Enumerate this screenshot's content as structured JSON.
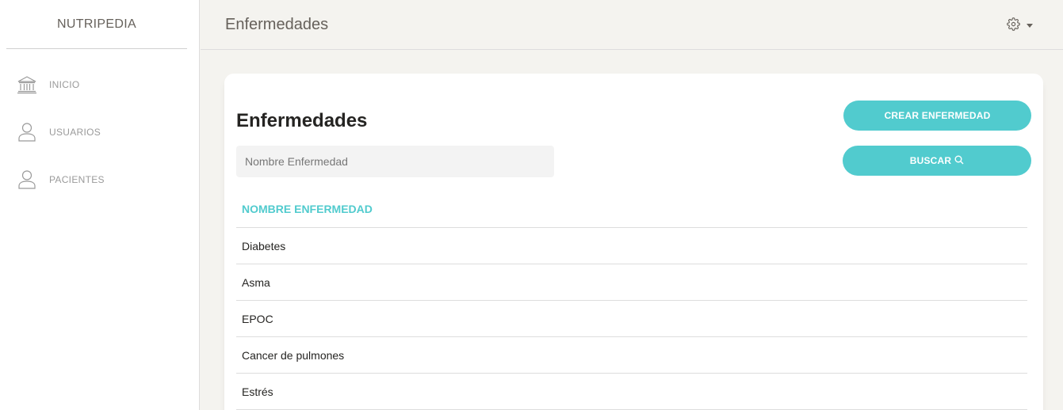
{
  "sidebar": {
    "brand": "NUTRIPEDIA",
    "items": [
      {
        "label": "INICIO",
        "icon": "bank-icon"
      },
      {
        "label": "USUARIOS",
        "icon": "user-icon"
      },
      {
        "label": "PACIENTES",
        "icon": "user-icon"
      }
    ]
  },
  "header": {
    "title": "Enfermedades",
    "settings_icon": "gear-icon"
  },
  "main": {
    "title": "Enfermedades",
    "search": {
      "placeholder": "Nombre Enfermedad",
      "value": ""
    },
    "create_button": "CREAR ENFERMEDAD",
    "search_button": "BUSCAR",
    "table": {
      "columns": [
        "NOMBRE ENFERMEDAD"
      ],
      "rows": [
        "Diabetes",
        "Asma",
        "EPOC",
        "Cancer de pulmones",
        "Estrés"
      ]
    }
  },
  "colors": {
    "accent": "#51cbce",
    "background": "#f4f3ef",
    "text": "#252422",
    "muted": "#9a9a9a"
  }
}
